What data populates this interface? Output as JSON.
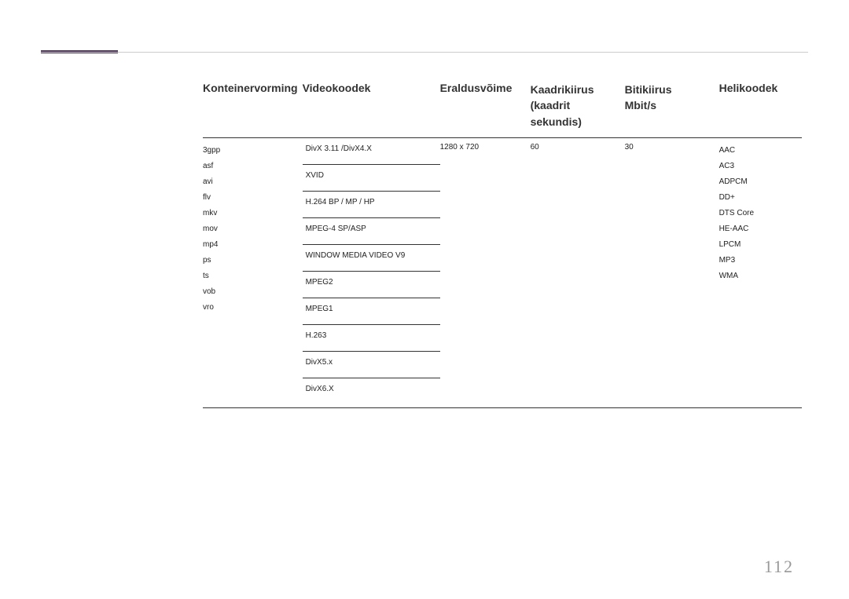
{
  "page_number": "112",
  "headers": {
    "container": "Konteinervorming",
    "videocodec": "Videokoodek",
    "resolution": "Eraldusvõime",
    "framerate_l1": "Kaadrikiirus",
    "framerate_l2": "(kaadrit sekundis)",
    "bitrate_l1": "Bitikiirus",
    "bitrate_l2": "Mbit/s",
    "audiocodec": "Helikoodek"
  },
  "containers": [
    "3gpp",
    "asf",
    "avi",
    "flv",
    "mkv",
    "mov",
    "mp4",
    "ps",
    "ts",
    "vob",
    "vro"
  ],
  "video_codecs": [
    "DivX 3.11 /DivX4.X",
    "XVID",
    "H.264 BP / MP / HP",
    "MPEG-4 SP/ASP",
    "WINDOW MEDIA VIDEO V9",
    "MPEG2",
    "MPEG1",
    "H.263",
    "DivX5.x",
    "DivX6.X"
  ],
  "resolution": "1280 x 720",
  "framerate": "60",
  "bitrate": "30",
  "audio_codecs": [
    "AAC",
    "AC3",
    "ADPCM",
    "DD+",
    "DTS Core",
    "HE-AAC",
    "LPCM",
    "MP3",
    "WMA"
  ]
}
